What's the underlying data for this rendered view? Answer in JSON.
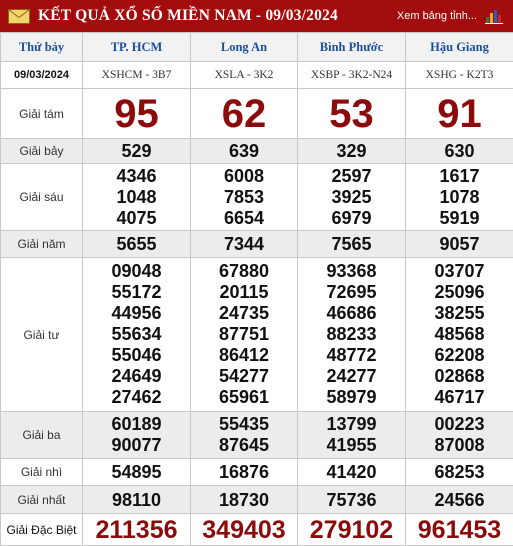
{
  "header": {
    "title": "KẾT QUẢ XỔ SỐ MIỀN NAM - 09/03/2024",
    "link": "Xem bảng tỉnh..."
  },
  "table": {
    "day": "Thứ bảy",
    "date": "09/03/2024",
    "provinces": [
      "TP. HCM",
      "Long An",
      "Bình Phước",
      "Hậu Giang"
    ],
    "codes": [
      "XSHCM - 3B7",
      "XSLA - 3K2",
      "XSBP - 3K2-N24",
      "XSHG - K2T3"
    ],
    "labels": {
      "g8": "Giải tám",
      "g7": "Giải bảy",
      "g6": "Giải sáu",
      "g5": "Giải năm",
      "g4": "Giải tư",
      "g3": "Giải ba",
      "g2": "Giải nhì",
      "g1": "Giải nhất",
      "db": "Giải Đặc Biệt"
    },
    "g8": [
      "95",
      "62",
      "53",
      "91"
    ],
    "g7": [
      "529",
      "639",
      "329",
      "630"
    ],
    "g6": [
      [
        "4346",
        "1048",
        "4075"
      ],
      [
        "6008",
        "7853",
        "6654"
      ],
      [
        "2597",
        "3925",
        "6979"
      ],
      [
        "1617",
        "1078",
        "5919"
      ]
    ],
    "g5": [
      "5655",
      "7344",
      "7565",
      "9057"
    ],
    "g4": [
      [
        "09048",
        "55172",
        "44956",
        "55634",
        "55046",
        "24649",
        "27462"
      ],
      [
        "67880",
        "20115",
        "24735",
        "87751",
        "86412",
        "54277",
        "65961"
      ],
      [
        "93368",
        "72695",
        "46686",
        "88233",
        "48772",
        "24277",
        "58979"
      ],
      [
        "03707",
        "25096",
        "38255",
        "48568",
        "62208",
        "02868",
        "46717"
      ]
    ],
    "g3": [
      [
        "60189",
        "90077"
      ],
      [
        "55435",
        "87645"
      ],
      [
        "13799",
        "41955"
      ],
      [
        "00223",
        "87008"
      ]
    ],
    "g2": [
      "54895",
      "16876",
      "41420",
      "68253"
    ],
    "g1": [
      "98110",
      "18730",
      "75736",
      "24566"
    ],
    "db": [
      "211356",
      "349403",
      "279102",
      "961453"
    ]
  },
  "colors": {
    "header_bg": "#a30c0c",
    "province_text": "#1d4e9e",
    "big_number": "#8b0a0a"
  }
}
